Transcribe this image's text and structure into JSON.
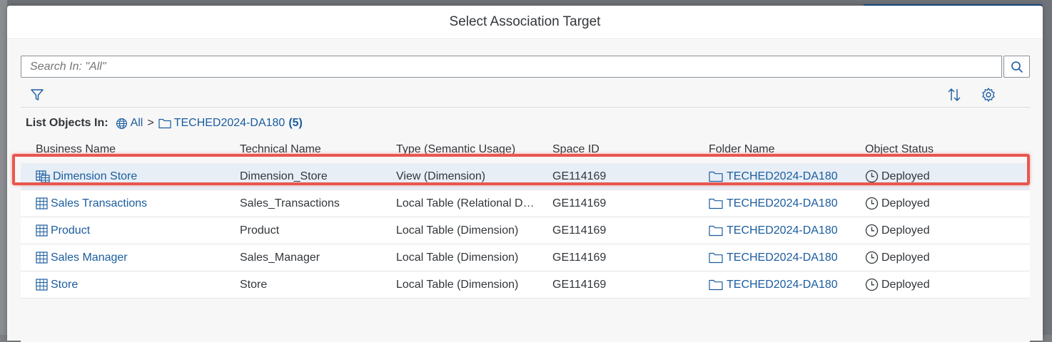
{
  "dialog": {
    "title": "Select Association Target"
  },
  "search": {
    "placeholder": "Search In: \"All\""
  },
  "toolbar": {
    "icons": [
      "filter-icon",
      "sort-icon",
      "settings-icon"
    ]
  },
  "breadcrumb": {
    "label": "List Objects In:",
    "root": "All",
    "separator": ">",
    "folder": "TECHED2024-DA180",
    "count": "(5)"
  },
  "table": {
    "columns": [
      "Business Name",
      "Technical Name",
      "Type (Semantic Usage)",
      "Space ID",
      "Folder Name",
      "Object Status"
    ],
    "rows": [
      {
        "business_name": "Dimension Store",
        "technical_name": "Dimension_Store",
        "type": "View (Dimension)",
        "space_id": "GE114169",
        "folder": "TECHED2024-DA180",
        "status": "Deployed",
        "icon": "view-icon",
        "selected": true
      },
      {
        "business_name": "Sales Transactions",
        "technical_name": "Sales_Transactions",
        "type": "Local Table (Relational D…",
        "space_id": "GE114169",
        "folder": "TECHED2024-DA180",
        "status": "Deployed",
        "icon": "table-icon",
        "selected": false
      },
      {
        "business_name": "Product",
        "technical_name": "Product",
        "type": "Local Table (Dimension)",
        "space_id": "GE114169",
        "folder": "TECHED2024-DA180",
        "status": "Deployed",
        "icon": "table-icon",
        "selected": false
      },
      {
        "business_name": "Sales Manager",
        "technical_name": "Sales_Manager",
        "type": "Local Table (Dimension)",
        "space_id": "GE114169",
        "folder": "TECHED2024-DA180",
        "status": "Deployed",
        "icon": "table-icon",
        "selected": false
      },
      {
        "business_name": "Store",
        "technical_name": "Store",
        "type": "Local Table (Dimension)",
        "space_id": "GE114169",
        "folder": "TECHED2024-DA180",
        "status": "Deployed",
        "icon": "table-icon",
        "selected": false
      }
    ]
  },
  "colors": {
    "link": "#1a5c9e",
    "highlight": "#e8574e",
    "selected_row": "#e8eef6"
  }
}
